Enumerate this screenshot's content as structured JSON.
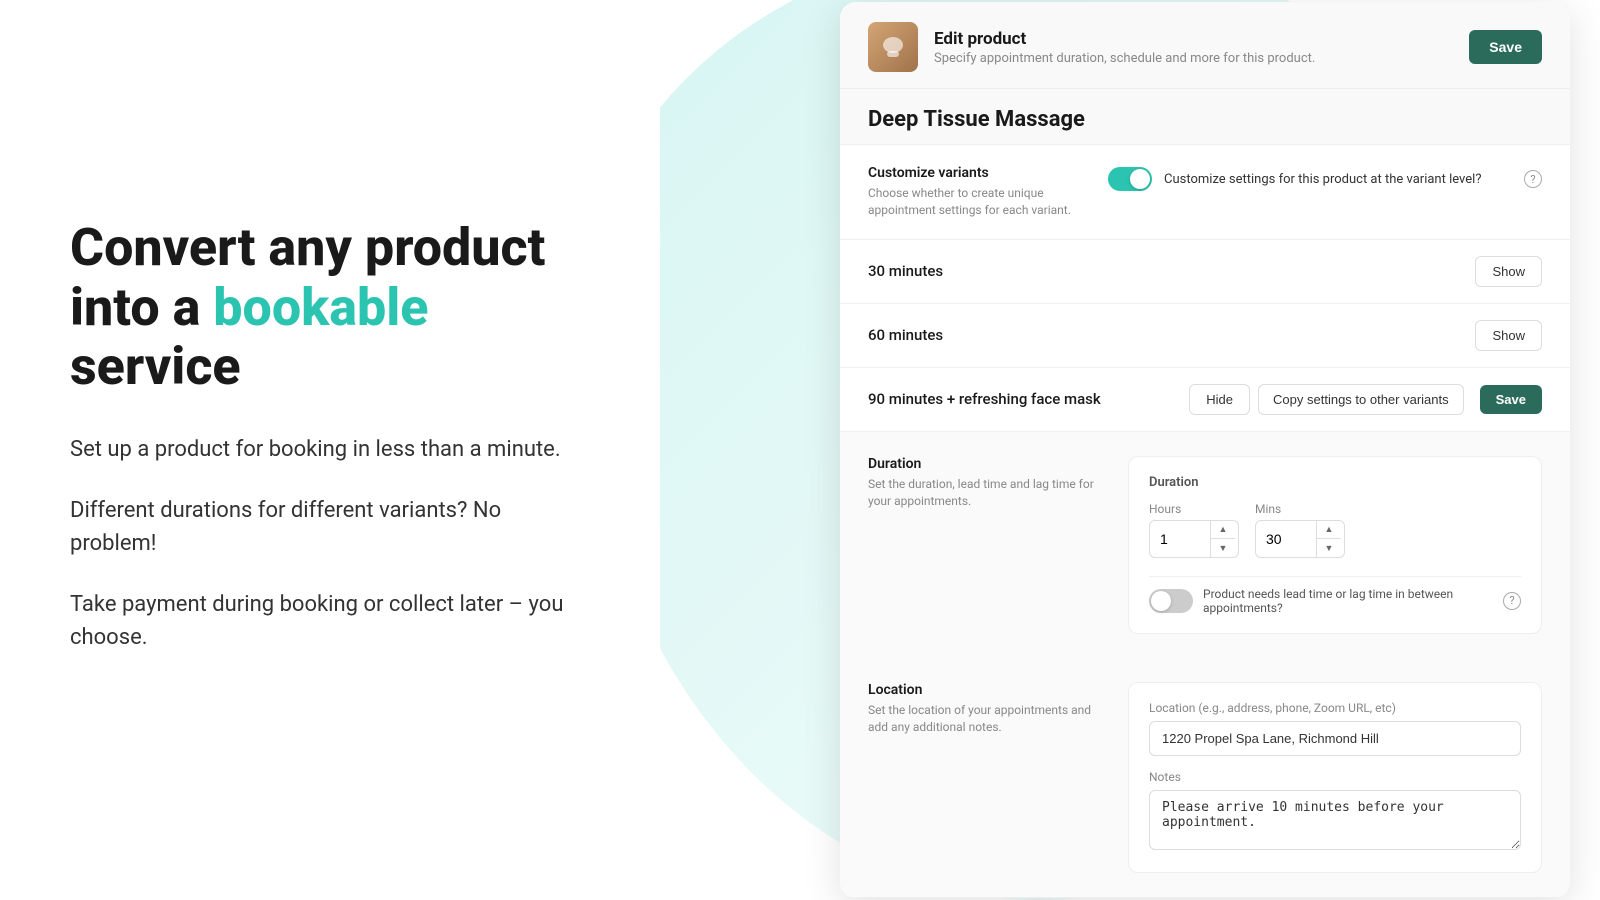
{
  "left": {
    "heading_line1": "Convert any product",
    "heading_line2_plain": "into a",
    "heading_line2_accent": "bookable",
    "heading_line2_end": "service",
    "para1": "Set up a product for booking in less than a minute.",
    "para2": "Different durations for different variants? No problem!",
    "para3": "Take payment during booking or collect later – you choose."
  },
  "card": {
    "header": {
      "title": "Edit product",
      "subtitle": "Specify appointment duration, schedule and more for this product.",
      "save_button": "Save"
    },
    "product_name": "Deep Tissue Massage",
    "customize_variants": {
      "label": "Customize variants",
      "description": "Choose whether to create unique appointment settings for each variant.",
      "toggle_on": true,
      "customize_text": "Customize settings for this product at the variant level?",
      "help_icon": "?"
    },
    "variants": [
      {
        "name": "30 minutes",
        "action": "Show",
        "expanded": false
      },
      {
        "name": "60 minutes",
        "action": "Show",
        "expanded": false
      },
      {
        "name": "90 minutes + refreshing face mask",
        "action": "Hide",
        "expanded": true,
        "copy_button": "Copy settings to other variants",
        "save_button": "Save"
      }
    ],
    "duration_section": {
      "label": "Duration",
      "description": "Set the duration, lead time and lag time for your appointments.",
      "heading": "Duration",
      "hours_label": "Hours",
      "hours_value": "1",
      "mins_label": "Mins",
      "mins_value": "30",
      "leadtime_label": "Product needs lead time or lag time in between appointments?",
      "leadtime_toggle_on": false
    },
    "location_section": {
      "label": "Location",
      "description": "Set the location of your appointments and add any additional notes.",
      "location_field_label": "Location (e.g., address, phone, Zoom URL, etc)",
      "location_value": "1220 Propel Spa Lane, Richmond Hill",
      "notes_label": "Notes",
      "notes_value": "Please arrive 10 minutes before your appointment."
    }
  },
  "colors": {
    "accent_teal": "#2bc4b0",
    "dark_green": "#2b6b5c"
  }
}
